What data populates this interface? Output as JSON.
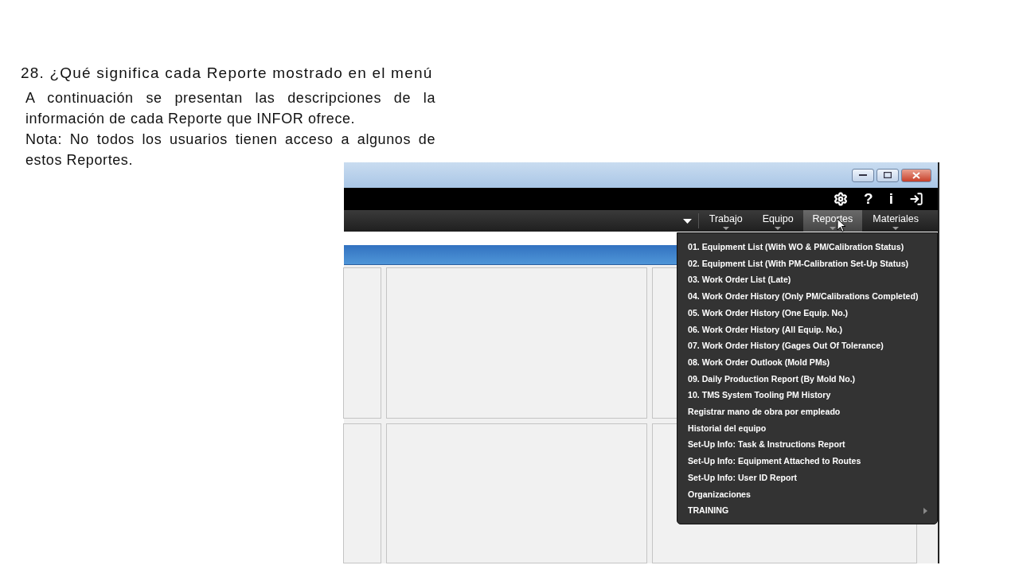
{
  "slide": {
    "title": "28. ¿Qué significa cada Reporte mostrado en el menú",
    "paragraphs": [
      "A continuación se presentan las descripciones de la información de cada Reporte que INFOR ofrece.",
      "Nota: No todos los usuarios tienen acceso a algunos de estos Reportes."
    ]
  },
  "app": {
    "top_bar": {
      "help_glyph": "?",
      "info_glyph": "i"
    },
    "nav_tabs": [
      {
        "label": "Trabajo",
        "selected": false
      },
      {
        "label": "Equipo",
        "selected": false
      },
      {
        "label": "Reportes",
        "selected": true
      },
      {
        "label": "Materiales",
        "selected": false
      }
    ],
    "reports_menu": [
      {
        "label": "01. Equipment List (With WO & PM/Calibration Status)",
        "kind": "item"
      },
      {
        "label": "02. Equipment List (With PM-Calibration Set-Up Status)",
        "kind": "item"
      },
      {
        "label": "03. Work Order List (Late)",
        "kind": "item"
      },
      {
        "label": "04. Work Order History (Only PM/Calibrations Completed)",
        "kind": "item"
      },
      {
        "label": "05. Work Order History (One Equip. No.)",
        "kind": "item"
      },
      {
        "label": "06. Work Order History (All Equip. No.)",
        "kind": "item"
      },
      {
        "label": "07. Work Order History (Gages Out Of Tolerance)",
        "kind": "item"
      },
      {
        "label": "08. Work Order Outlook (Mold PMs)",
        "kind": "item"
      },
      {
        "label": "09. Daily Production Report (By Mold No.)",
        "kind": "item"
      },
      {
        "label": "10. TMS System Tooling PM History",
        "kind": "item"
      },
      {
        "label": "Registrar mano de obra por empleado",
        "kind": "item"
      },
      {
        "label": "Historial del equipo",
        "kind": "item"
      },
      {
        "label": "Set-Up Info: Task & Instructions Report",
        "kind": "item"
      },
      {
        "label": "Set-Up Info: Equipment Attached to Routes",
        "kind": "item"
      },
      {
        "label": "Set-Up Info: User ID Report",
        "kind": "item"
      },
      {
        "label": "Organizaciones",
        "kind": "item"
      },
      {
        "label": "TRAINING",
        "kind": "submenu"
      }
    ]
  }
}
